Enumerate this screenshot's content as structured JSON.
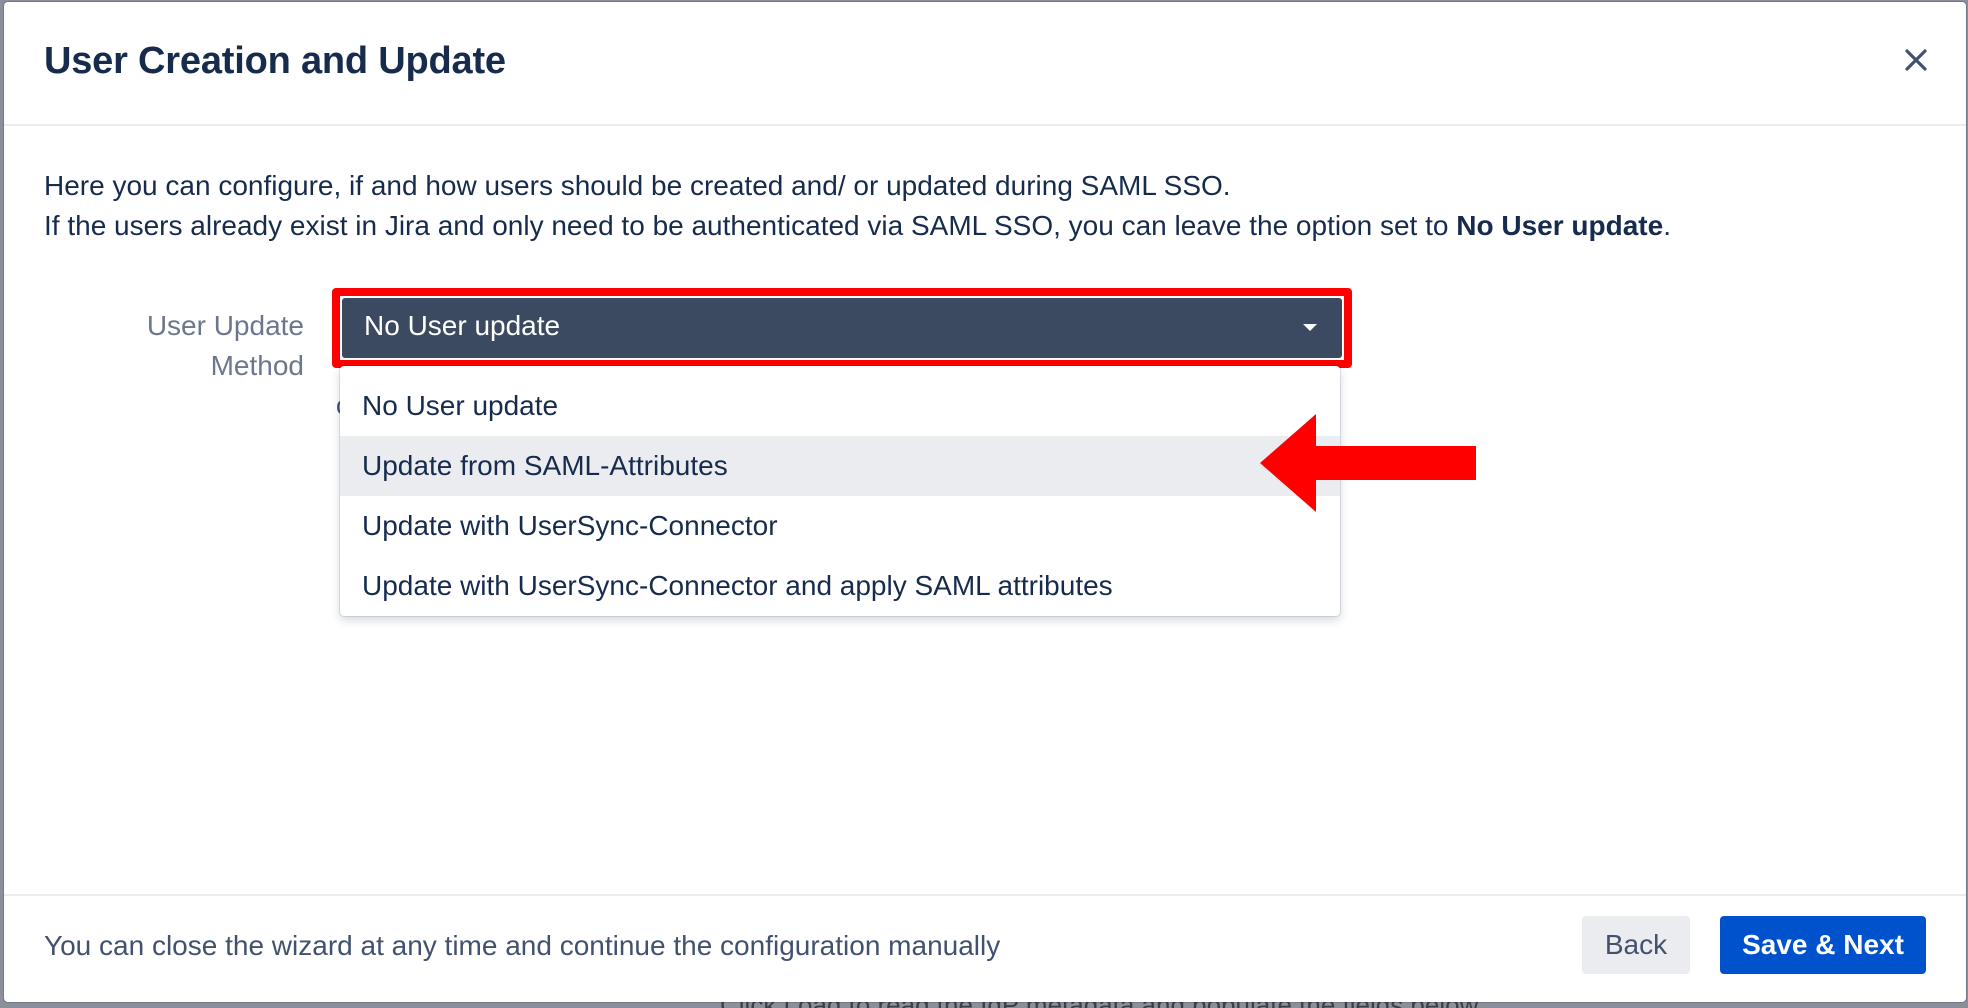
{
  "backdrop": {
    "partial_text": "Click Load to read the IdP metadata and populate the fields below"
  },
  "dialog": {
    "title": "User Creation and Update",
    "close_icon": "close-icon"
  },
  "intro": {
    "line1": "Here you can configure, if and how users should be created and/ or updated during SAML SSO.",
    "line2_prefix": "If the users already exist in Jira and only need to be authenticated via SAML SSO, you can leave the option set to ",
    "line2_bold": "No User update",
    "line2_suffix": "."
  },
  "form": {
    "label_line1": "User Update",
    "label_line2": "Method",
    "selected_value": "No User update",
    "stray_char": "c",
    "options": [
      {
        "label": "No User update"
      },
      {
        "label": "Update from SAML-Attributes"
      },
      {
        "label": "Update with UserSync-Connector"
      },
      {
        "label": "Update with UserSync-Connector and apply SAML attributes"
      }
    ],
    "highlight_color": "#ff0000"
  },
  "footer": {
    "note": "You can close the wizard at any time and continue the configuration manually",
    "back_label": "Back",
    "save_label": "Save & Next",
    "primary_color": "#0052cc"
  }
}
